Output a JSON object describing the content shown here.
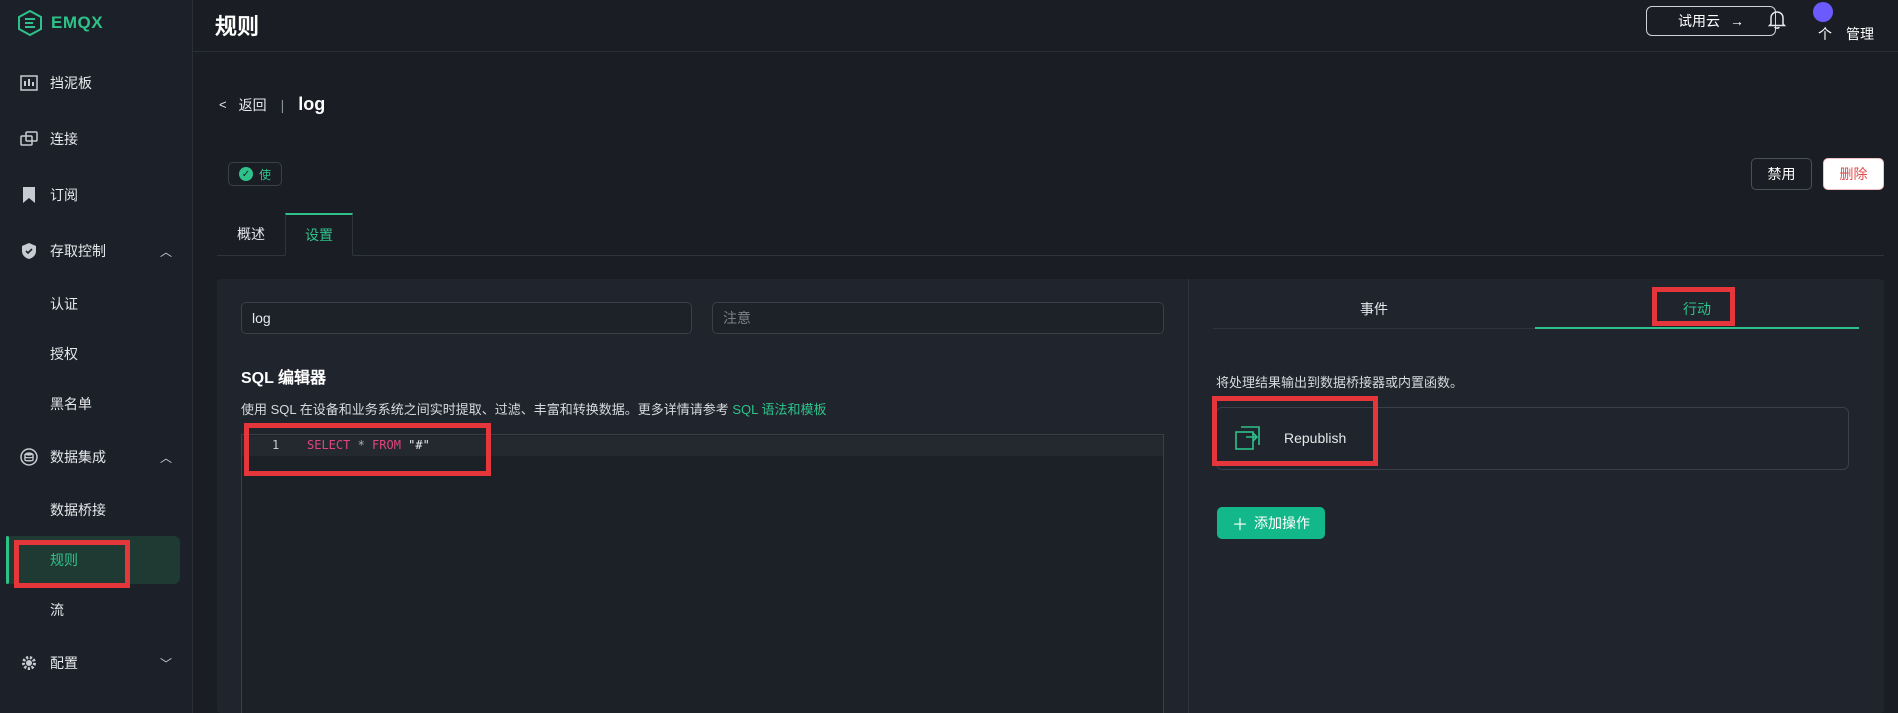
{
  "app": {
    "logo_text": "EMQX"
  },
  "sidebar": {
    "items": [
      {
        "label": "挡泥板",
        "icon": "dashboard-icon"
      },
      {
        "label": "连接",
        "icon": "connections-icon"
      },
      {
        "label": "订阅",
        "icon": "subscriptions-icon"
      },
      {
        "label": "存取控制",
        "icon": "shield-icon",
        "expanded": true,
        "children": [
          {
            "label": "认证"
          },
          {
            "label": "授权"
          },
          {
            "label": "黑名单"
          }
        ]
      },
      {
        "label": "数据集成",
        "icon": "data-integration-icon",
        "expanded": true,
        "children": [
          {
            "label": "数据桥接"
          },
          {
            "label": "规则",
            "active": true
          },
          {
            "label": "流"
          }
        ]
      },
      {
        "label": "配置",
        "icon": "gear-icon",
        "expanded": false
      }
    ]
  },
  "header": {
    "title": "规则",
    "cloud_button": "试用云",
    "user_name": "个　管理"
  },
  "breadcrumb": {
    "back_label": "返回",
    "separator": "|",
    "rule_name": "log"
  },
  "rule": {
    "status_label": "使",
    "disable_label": "禁用",
    "delete_label": "删除"
  },
  "tabs": {
    "overview": "概述",
    "settings": "设置",
    "active": "settings"
  },
  "form": {
    "name_value": "log",
    "note_placeholder": "注意",
    "sql_title": "SQL 编辑器",
    "sql_desc": "使用 SQL 在设备和业务系统之间实时提取、过滤、丰富和转换数据。更多详情请参考 ",
    "sql_link": "SQL 语法和模板"
  },
  "editor": {
    "line_number": "1",
    "tokens": {
      "select": "SELECT",
      "star": " * ",
      "from": "FROM",
      "topic": " \"#\""
    }
  },
  "actions_panel": {
    "tab_events": "事件",
    "tab_actions": "行动",
    "active_tab": "actions",
    "description": "将处理结果输出到数据桥接器或内置函数。",
    "action_label": "Republish",
    "action_icon": "republish-icon",
    "add_button": "添加操作"
  },
  "colors": {
    "accent": "#2ec28a",
    "highlight": "#e5373b",
    "background": "#1a1d24"
  }
}
